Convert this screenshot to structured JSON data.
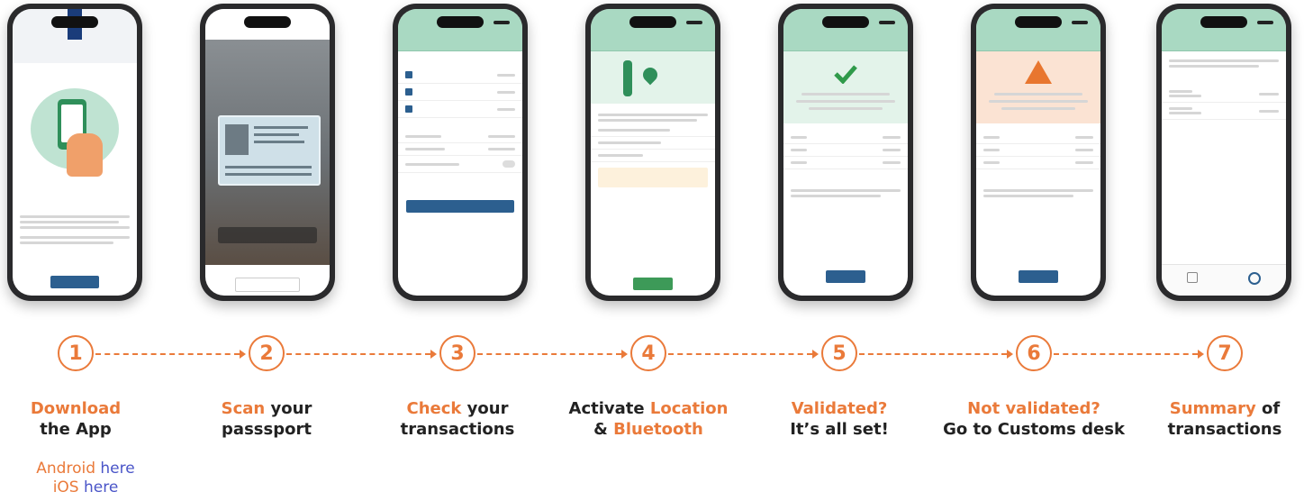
{
  "steps": [
    {
      "number": "1",
      "line1_hl": "Download",
      "line1_rest": "",
      "line2_pre": "the App",
      "line2_hl": "",
      "line2_post": ""
    },
    {
      "number": "2",
      "line1_hl": "Scan",
      "line1_rest": " your",
      "line2_pre": "passsport",
      "line2_hl": "",
      "line2_post": ""
    },
    {
      "number": "3",
      "line1_hl": "Check",
      "line1_rest": " your",
      "line2_pre": "transactions",
      "line2_hl": "",
      "line2_post": ""
    },
    {
      "number": "4",
      "line1_pre": "Activate ",
      "line1_hl": "Location",
      "line1_rest": "",
      "line2_pre": "& ",
      "line2_hl": "Bluetooth",
      "line2_post": ""
    },
    {
      "number": "5",
      "line1_hl": "Validated?",
      "line1_rest": "",
      "line2_pre": "It’s all set!",
      "line2_hl": "",
      "line2_post": ""
    },
    {
      "number": "6",
      "line1_hl": "Not validated?",
      "line1_rest": "",
      "line2_pre": "Go to Customs desk",
      "line2_hl": "",
      "line2_post": ""
    },
    {
      "number": "7",
      "line1_hl": "Summary",
      "line1_rest": " of",
      "line2_pre": "transactions",
      "line2_hl": "",
      "line2_post": ""
    }
  ],
  "download_links": {
    "android_label": "Android",
    "android_link": "here",
    "ios_label": "iOS",
    "ios_link": "here"
  },
  "colors": {
    "accent": "#ea7a3a",
    "link": "#4a55c8",
    "app_header": "#a9d9c2",
    "app_button": "#2c5f8f"
  },
  "icons": [
    "phone-checklist-icon",
    "check-mark-icon",
    "warning-triangle-icon",
    "location-pin-icon",
    "arrow-right-icon"
  ]
}
